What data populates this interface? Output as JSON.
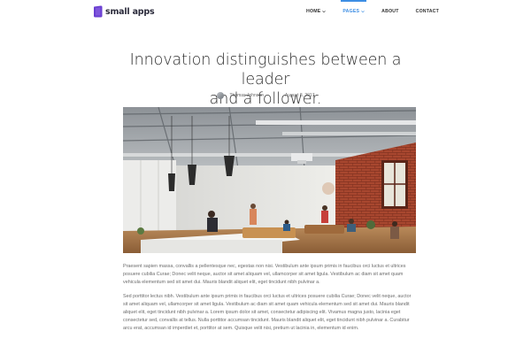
{
  "brand": {
    "name": "small apps",
    "accent": "#3d8ee4",
    "logo_color": "#6a3fd1"
  },
  "nav": {
    "items": [
      {
        "label": "HOME",
        "has_dropdown": true,
        "active": false
      },
      {
        "label": "PAGES",
        "has_dropdown": true,
        "active": true
      },
      {
        "label": "ABOUT",
        "has_dropdown": false,
        "active": false
      },
      {
        "label": "CONTACT",
        "has_dropdown": false,
        "active": false
      }
    ]
  },
  "article": {
    "title_line1": "Innovation distinguishes between a leader",
    "title_line2": "and a follower.",
    "author": "Thomas Johnson",
    "date": "August 8, 2017",
    "paragraphs": [
      "Praesent sapien massa, convallis a pellentesque nec, egestas non nisi. Vestibulum ante ipsum primis in faucibus orci luctus et ultrices posuere cubilia Curae; Donec velit neque, auctor sit amet aliquam vel, ullamcorper sit amet ligula. Vestibulum ac diam sit amet quam vehicula elementum sed sit amet dui. Mauris blandit aliquet elit, eget tincidunt nibh pulvinar a.",
      "Sed porttitor lectus nibh. Vestibulum ante ipsum primis in faucibus orci luctus et ultrices posuere cubilia Curae; Donec velit neque, auctor sit amet aliquam vel, ullamcorper sit amet ligula. Vestibulum ac diam sit amet quam vehicula elementum sed sit amet dui. Mauris blandit aliquet elit, eget tincidunt nibh pulvinar a. Lorem ipsum dolor sit amet, consectetur adipiscing elit. Vivamus magna justo, lacinia eget consectetur sed, convallis at tellus. Nulla porttitor accumsan tincidunt. Mauris blandit aliquet elit, eget tincidunt nibh pulvinar a. Curabitur arcu erat, accumsan id imperdiet et, porttitor at sem. Quisque velit nisi, pretium ut lacinia in, elementum id enim."
    ]
  },
  "icons": {
    "logo": "small-apps-logo-icon",
    "dropdown": "chevron-down-icon",
    "author_avatar": "avatar-icon"
  }
}
